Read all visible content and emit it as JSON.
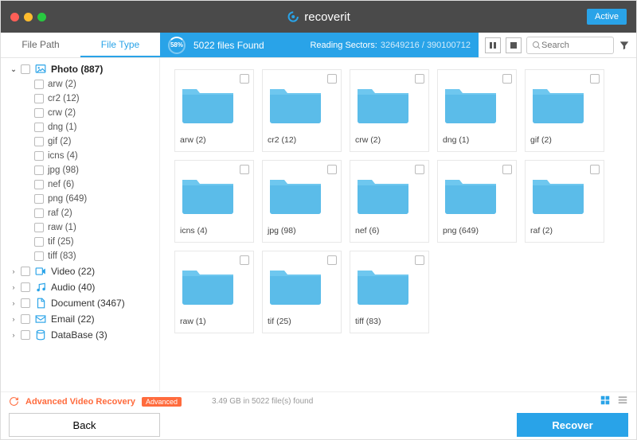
{
  "window": {
    "brand": "recoverit",
    "active_label": "Active",
    "traffic_colors": [
      "#ff5f57",
      "#febc2e",
      "#28c840"
    ]
  },
  "tabs": {
    "path": "File Path",
    "type": "File Type",
    "active": "type"
  },
  "scan": {
    "percent": "58%",
    "found": "5022 files Found",
    "reading_label": "Reading Sectors:",
    "reading_value": "32649216 / 390100712"
  },
  "search": {
    "placeholder": "Search"
  },
  "sidebar": {
    "categories": [
      {
        "label": "Photo (887)",
        "icon": "photo",
        "expanded": true,
        "children": [
          "arw (2)",
          "cr2 (12)",
          "crw (2)",
          "dng (1)",
          "gif (2)",
          "icns (4)",
          "jpg (98)",
          "nef (6)",
          "png (649)",
          "raf (2)",
          "raw (1)",
          "tif (25)",
          "tiff (83)"
        ]
      },
      {
        "label": "Video (22)",
        "icon": "video"
      },
      {
        "label": "Audio (40)",
        "icon": "audio"
      },
      {
        "label": "Document (3467)",
        "icon": "document"
      },
      {
        "label": "Email (22)",
        "icon": "email"
      },
      {
        "label": "DataBase (3)",
        "icon": "database"
      }
    ]
  },
  "grid_folders": [
    "arw (2)",
    "cr2 (12)",
    "crw (2)",
    "dng (1)",
    "gif (2)",
    "icns (4)",
    "jpg (98)",
    "nef (6)",
    "png (649)",
    "raf (2)",
    "raw (1)",
    "tif (25)",
    "tiff (83)"
  ],
  "avr": {
    "text": "Advanced Video Recovery",
    "badge": "Advanced"
  },
  "summary": "3.49 GB in 5022 file(s) found",
  "footer": {
    "back": "Back",
    "recover": "Recover"
  }
}
